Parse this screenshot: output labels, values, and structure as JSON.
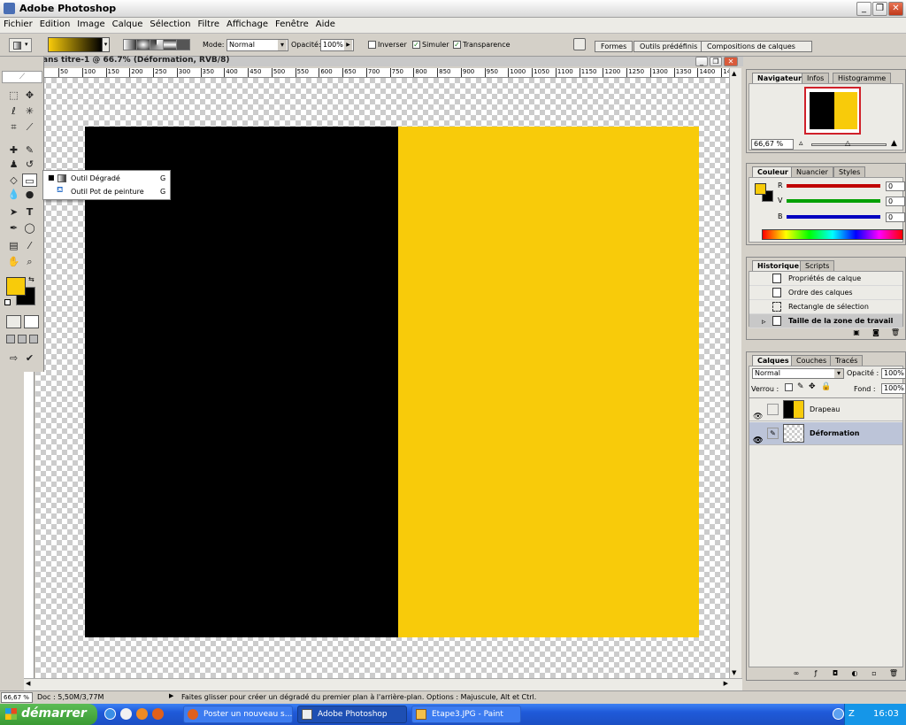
{
  "app": {
    "title": "Adobe Photoshop"
  },
  "menu": [
    "Fichier",
    "Edition",
    "Image",
    "Calque",
    "Sélection",
    "Filtre",
    "Affichage",
    "Fenêtre",
    "Aide"
  ],
  "options": {
    "mode_label": "Mode:",
    "mode_value": "Normal",
    "opacity_label": "Opacité:",
    "opacity_value": "100%",
    "inverser": "Inverser",
    "simuler": "Simuler",
    "transparence": "Transparence",
    "inverser_checked": false,
    "simuler_checked": true,
    "transparence_checked": true
  },
  "palette_well": [
    "Formes",
    "Outils prédéfinis",
    "Compositions de calques"
  ],
  "document": {
    "title": "ans titre-1 @ 66.7% (Déformation, RVB/8)",
    "ruler_ticks": [
      "50",
      "100",
      "150",
      "200",
      "250",
      "300",
      "350",
      "400",
      "450",
      "500",
      "550",
      "600",
      "650",
      "700",
      "750",
      "800",
      "850",
      "900",
      "950",
      "1000",
      "1050",
      "1100",
      "1150",
      "1200",
      "1250",
      "1300",
      "1350",
      "1400",
      "14"
    ],
    "flag_colors": {
      "left": "#000000",
      "right": "#f8cb0a"
    }
  },
  "flyout": {
    "items": [
      {
        "label": "Outil Dégradé",
        "shortcut": "G",
        "active": true
      },
      {
        "label": "Outil Pot de peinture",
        "shortcut": "G",
        "active": false
      }
    ]
  },
  "navigator": {
    "tabs": [
      "Navigateur",
      "Infos",
      "Histogramme"
    ],
    "zoom": "66,67 %"
  },
  "color_panel": {
    "tabs": [
      "Couleur",
      "Nuancier",
      "Styles"
    ],
    "channels": [
      {
        "label": "R",
        "value": "0",
        "color": "#c00000"
      },
      {
        "label": "V",
        "value": "0",
        "color": "#00a000"
      },
      {
        "label": "B",
        "value": "0",
        "color": "#0000c0"
      }
    ],
    "foreground": "#f8cb0a",
    "background": "#000000"
  },
  "history": {
    "tabs": [
      "Historique",
      "Scripts"
    ],
    "items": [
      {
        "label": "Propriétés de calque",
        "active": false
      },
      {
        "label": "Ordre des calques",
        "active": false
      },
      {
        "label": "Rectangle de sélection",
        "active": false
      },
      {
        "label": "Taille de la zone de travail",
        "active": true
      }
    ]
  },
  "layers": {
    "tabs": [
      "Calques",
      "Couches",
      "Tracés"
    ],
    "blend_mode": "Normal",
    "opacity_label": "Opacité :",
    "opacity_value": "100%",
    "lock_label": "Verrou :",
    "fill_label": "Fond :",
    "fill_value": "100%",
    "items": [
      {
        "name": "Drapeau",
        "selected": false
      },
      {
        "name": "Déformation",
        "selected": true
      }
    ]
  },
  "status": {
    "zoom": "66,67 %",
    "doc": "Doc : 5,50M/3,77M",
    "hint": "Faites glisser pour créer un dégradé du premier plan à l'arrière-plan. Options : Majuscule, Alt et Ctrl."
  },
  "taskbar": {
    "start": "démarrer",
    "tasks": [
      "Poster un nouveau s...",
      "Adobe Photoshop",
      "Etape3.JPG - Paint"
    ],
    "clock": "16:03"
  }
}
